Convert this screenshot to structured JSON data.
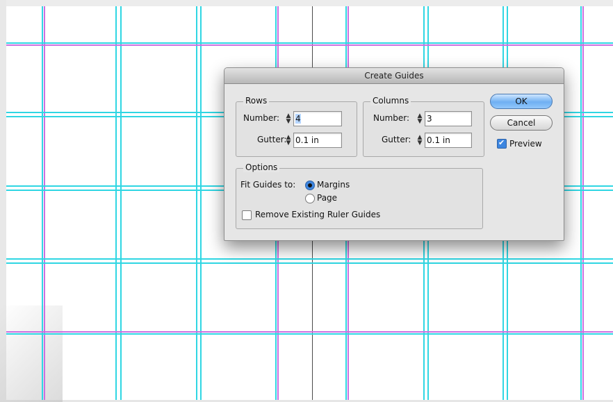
{
  "dialog": {
    "title": "Create Guides",
    "rows": {
      "legend": "Rows",
      "number_label": "Number:",
      "number_value": "4",
      "gutter_label": "Gutter:",
      "gutter_value": "0.1 in"
    },
    "columns": {
      "legend": "Columns",
      "number_label": "Number:",
      "number_value": "3",
      "gutter_label": "Gutter:",
      "gutter_value": "0.1 in"
    },
    "options": {
      "legend": "Options",
      "fit_label": "Fit Guides to:",
      "fit_choices": [
        "Margins",
        "Page"
      ],
      "fit_selected": "Margins",
      "remove_label": "Remove Existing Ruler Guides",
      "remove_checked": false
    },
    "buttons": {
      "ok": "OK",
      "cancel": "Cancel"
    },
    "preview": {
      "label": "Preview",
      "checked": true
    }
  },
  "colors": {
    "guide_cyan": "#2fd6e3",
    "guide_magenta": "#cc6fe0",
    "dialog_bg": "#e6e6e6",
    "default_button": "#6fb0f2"
  }
}
